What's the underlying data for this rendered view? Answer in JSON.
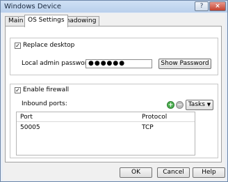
{
  "window": {
    "title": "Windows Device",
    "help_label": "?",
    "close_label": "×"
  },
  "tabs": [
    {
      "label": "Main"
    },
    {
      "label": "OS Settings"
    },
    {
      "label": "Shadowing"
    }
  ],
  "os_settings": {
    "replace_desktop": {
      "label": "Replace desktop",
      "checked": true
    },
    "local_admin_password": {
      "label": "Local admin password:",
      "value": "●●●●●●"
    },
    "show_password_label": "Show Password",
    "enable_firewall": {
      "label": "Enable firewall",
      "checked": true
    },
    "inbound_ports_label": "Inbound ports:",
    "tasks_label": "Tasks",
    "ports_table": {
      "columns": [
        "Port",
        "Protocol"
      ],
      "rows": [
        {
          "port": "50005",
          "protocol": "TCP"
        }
      ]
    }
  },
  "footer": {
    "ok_label": "OK",
    "cancel_label": "Cancel",
    "help_label": "Help"
  },
  "colors": {
    "add_icon": "#4caf50",
    "remove_icon": "#9e9e9e"
  }
}
